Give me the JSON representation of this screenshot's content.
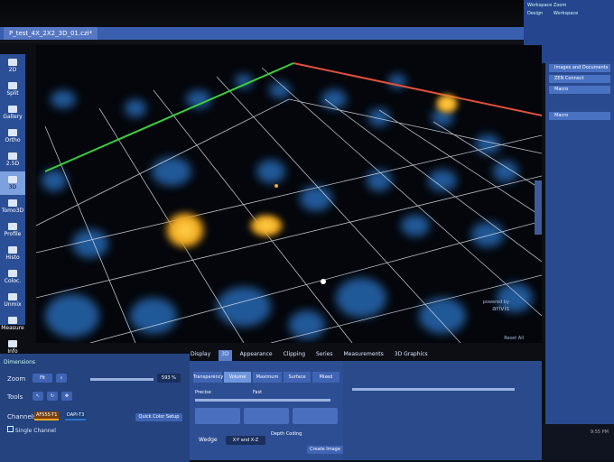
{
  "window": {
    "tab_title": "P_test_4X_2X2_3D_01.czi*",
    "workspace_label": "Workspace Zoom",
    "design_label": "Design",
    "workspace_value": "Workspace"
  },
  "left_toolbar": {
    "items": [
      {
        "label": "2D"
      },
      {
        "label": "Split"
      },
      {
        "label": "Gallery"
      },
      {
        "label": "Ortho"
      },
      {
        "label": "2.5D"
      },
      {
        "label": "3D"
      },
      {
        "label": "Tomo3D"
      },
      {
        "label": "Profile"
      },
      {
        "label": "Histo"
      },
      {
        "label": "Coloc."
      },
      {
        "label": "Unmix"
      },
      {
        "label": "Measure"
      },
      {
        "label": "Info"
      }
    ],
    "active_index": 5
  },
  "viewport": {
    "brand": "arivis",
    "brand_prefix": "powered by",
    "reset_label": "Reset All"
  },
  "right_panel": {
    "items": [
      {
        "label": "Images and Documents"
      },
      {
        "label": "ZEN Connect"
      },
      {
        "label": "Macro"
      }
    ],
    "macro_label": "Macro"
  },
  "view_tabs": {
    "items": [
      {
        "label": "Display"
      },
      {
        "label": "3D"
      },
      {
        "label": "Appearance"
      },
      {
        "label": "Clipping"
      },
      {
        "label": "Series"
      },
      {
        "label": "Measurements"
      },
      {
        "label": "3D Graphics"
      }
    ],
    "selected_index": 1
  },
  "dimensions": {
    "section_label": "Dimensions",
    "zoom_label": "Zoom",
    "zoom_value": "593 %",
    "fit_label": "Fit",
    "tools_label": "Tools",
    "channels_label": "Channels",
    "channel_1": "AF555-T1",
    "channel_2": "DAPI-T3",
    "single_channel_label": "Single Channel",
    "quick_color_label": "Quick Color Setup"
  },
  "render_modes": {
    "items": [
      {
        "label": "Transparency"
      },
      {
        "label": "Volume"
      },
      {
        "label": "Maximum"
      },
      {
        "label": "Surface"
      },
      {
        "label": "Mixed"
      }
    ],
    "selected_index": 1,
    "precise_label": "Precise",
    "fast_label": "Fast"
  },
  "wedge": {
    "label": "Wedge",
    "value": "X-Y and X-Z",
    "depth_coding_label": "Depth Coding",
    "create_image_label": "Create Image"
  },
  "colors": {
    "dapi": "#2b74c8",
    "af555": "#f0a820",
    "axis_green": "#3ccf3c",
    "axis_red": "#e0503a"
  },
  "taskbar": {
    "time": "9:55 PM"
  }
}
